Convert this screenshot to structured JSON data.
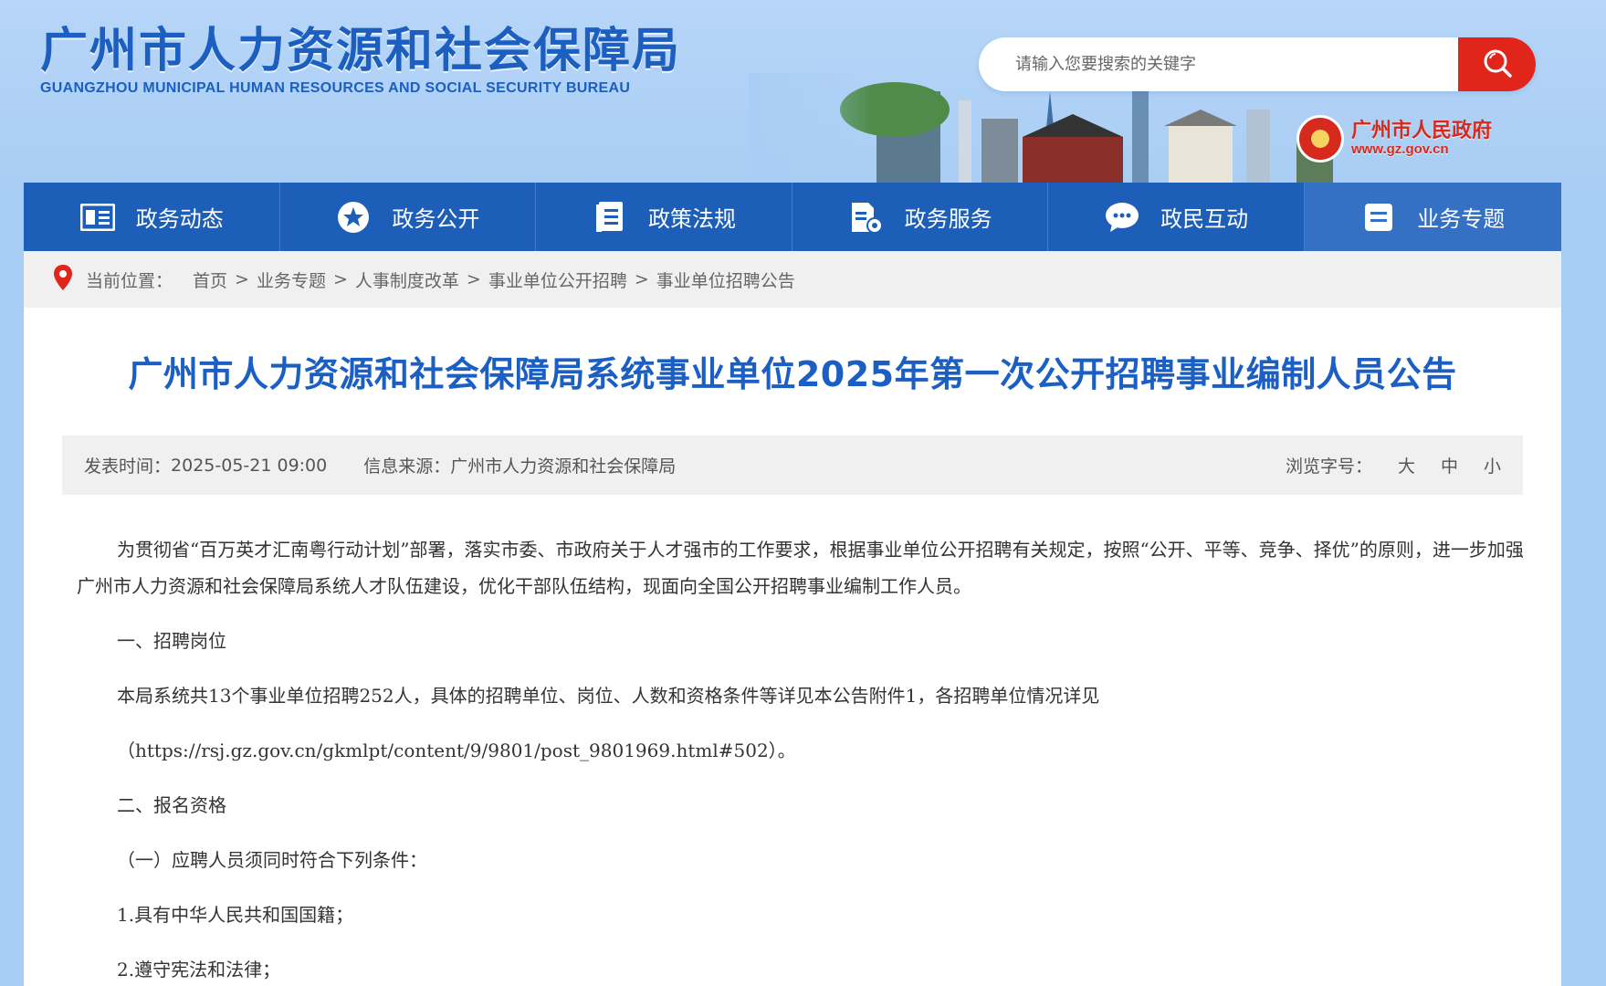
{
  "header": {
    "logo_cn": "广州市人力资源和社会保障局",
    "logo_en": "GUANGZHOU MUNICIPAL HUMAN RESOURCES AND SOCIAL SECURITY BUREAU",
    "search_placeholder": "请输入您要搜索的关键字",
    "gov_name": "广州市人民政府",
    "gov_url": "www.gz.gov.cn"
  },
  "nav": {
    "items": [
      {
        "label": "政务动态",
        "icon": "newspaper-icon"
      },
      {
        "label": "政务公开",
        "icon": "star-icon"
      },
      {
        "label": "政策法规",
        "icon": "document-list-icon"
      },
      {
        "label": "政务服务",
        "icon": "document-settings-icon"
      },
      {
        "label": "政民互动",
        "icon": "chat-bubble-icon"
      },
      {
        "label": "业务专题",
        "icon": "list-icon"
      }
    ],
    "active_index": 5
  },
  "breadcrumb": {
    "label": "当前位置：",
    "items": [
      "首页",
      "业务专题",
      "人事制度改革",
      "事业单位公开招聘",
      "事业单位招聘公告"
    ],
    "separator": ">"
  },
  "article": {
    "title": "广州市人力资源和社会保障局系统事业单位2025年第一次公开招聘事业编制人员公告",
    "meta": {
      "date_label": "发表时间：",
      "date": "2025-05-21 09:00",
      "source_label": "信息来源：",
      "source": "广州市人力资源和社会保障局",
      "font_label": "浏览字号：",
      "font_large": "大",
      "font_medium": "中",
      "font_small": "小"
    },
    "paragraphs": [
      "为贯彻省“百万英才汇南粤行动计划”部署，落实市委、市政府关于人才强市的工作要求，根据事业单位公开招聘有关规定，按照“公开、平等、竞争、择优”的原则，进一步加强广州市人力资源和社会保障局系统人才队伍建设，优化干部队伍结构，现面向全国公开招聘事业编制工作人员。",
      "一、招聘岗位",
      "本局系统共13个事业单位招聘252人，具体的招聘单位、岗位、人数和资格条件等详见本公告附件1，各招聘单位情况详见",
      "（https://rsj.gz.gov.cn/gkmlpt/content/9/9801/post_9801969.html#502）。",
      "二、报名资格",
      "（一）应聘人员须同时符合下列条件：",
      "1.具有中华人民共和国国籍；",
      "2.遵守宪法和法律；"
    ]
  },
  "colors": {
    "brand_blue": "#1d5fb8",
    "title_blue": "#1b5fc4",
    "search_red": "#e1251b",
    "gov_red": "#d62a1f"
  }
}
